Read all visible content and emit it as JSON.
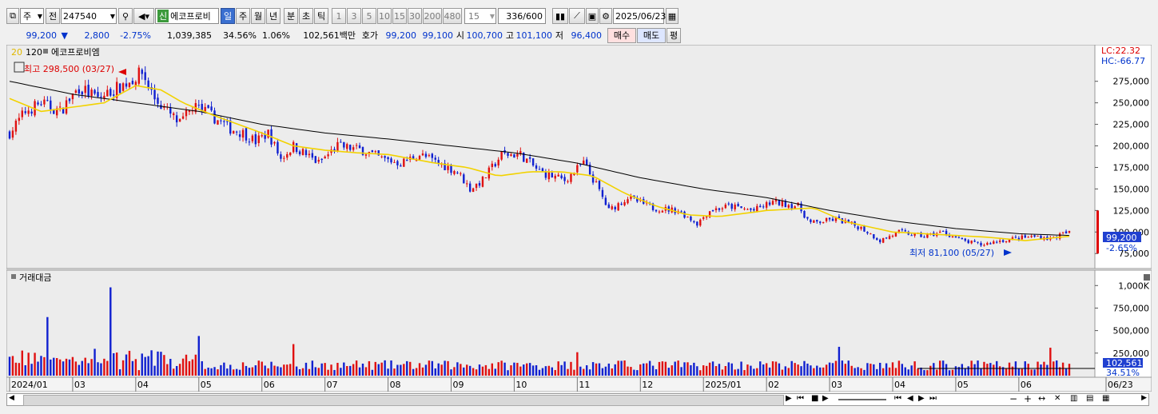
{
  "toolbar": {
    "period_select": "주",
    "prev_label": "전",
    "code": "247540",
    "name_badge": "신",
    "name": "에코프로비",
    "period_tabs": [
      "일",
      "주",
      "월",
      "년",
      "분",
      "초",
      "틱"
    ],
    "interval_buttons": [
      "1",
      "3",
      "5",
      "10",
      "15",
      "30",
      "200",
      "480"
    ],
    "interval_value": "15",
    "count_value": "336/600",
    "date_value": "2025/06/23"
  },
  "info": {
    "price": "99,200",
    "change": "2,800",
    "change_pct": "-2.75%",
    "volume": "1,039,385",
    "volume_ratio": "34.56%",
    "turnover_rate": "1.06%",
    "amount": "102,561백만",
    "ask_bid_label": "호가",
    "bid": "99,200",
    "ask": "99,100",
    "open_label": "시",
    "open": "100,700",
    "high_label": "고",
    "high": "101,100",
    "low_label": "저",
    "low": "96,400",
    "buy_label": "매수",
    "sell_label": "매도",
    "eval_label": "평"
  },
  "price_pane": {
    "legend_ma1": "20",
    "legend_ma2": "120",
    "legend_name": "에코프로비엠",
    "high_marker": "최고 298,500 (03/27)",
    "low_marker": "최저 81,100 (05/27)",
    "lc": "LC:22.32",
    "hc": "HC:-66.77",
    "current_price": "99,200",
    "current_pct": "-2.65%"
  },
  "volume_pane": {
    "title": "거래대금",
    "current": "102,561",
    "pct": "34.51%"
  },
  "colors": {
    "up": "#e01010",
    "down": "#1020d0",
    "ma20": "#f2d200",
    "ma120": "#000000"
  },
  "chart_data": {
    "type": "candlestick",
    "price_axis_ticks": [
      "275,000",
      "250,000",
      "225,000",
      "200,000",
      "175,000",
      "150,000",
      "125,000",
      "100,000",
      "75,000"
    ],
    "price_range": [
      65000,
      310000
    ],
    "volume_axis_ticks": [
      "1,000K",
      "750,000",
      "500,000",
      "250,000"
    ],
    "volume_range": [
      0,
      1100000
    ],
    "x_labels": [
      "2024/01",
      "03",
      "04",
      "05",
      "06",
      "07",
      "08",
      "09",
      "10",
      "11",
      "12",
      "2025/01",
      "02",
      "03",
      "04",
      "05",
      "06",
      "06/23"
    ],
    "x_label_index": [
      0,
      20,
      40,
      60,
      80,
      100,
      120,
      140,
      160,
      180,
      200,
      220,
      240,
      260,
      280,
      300,
      320,
      336
    ],
    "close_path": [
      [
        0,
        215000
      ],
      [
        5,
        240000
      ],
      [
        10,
        250000
      ],
      [
        16,
        240000
      ],
      [
        22,
        268000
      ],
      [
        28,
        255000
      ],
      [
        33,
        265000
      ],
      [
        38,
        275000
      ],
      [
        42,
        285000
      ],
      [
        44,
        270000
      ],
      [
        46,
        255000
      ],
      [
        50,
        240000
      ],
      [
        54,
        225000
      ],
      [
        58,
        245000
      ],
      [
        62,
        240000
      ],
      [
        66,
        230000
      ],
      [
        70,
        220000
      ],
      [
        74,
        215000
      ],
      [
        78,
        205000
      ],
      [
        82,
        215000
      ],
      [
        86,
        185000
      ],
      [
        90,
        200000
      ],
      [
        94,
        190000
      ],
      [
        98,
        180000
      ],
      [
        104,
        200000
      ],
      [
        112,
        195000
      ],
      [
        118,
        185000
      ],
      [
        124,
        180000
      ],
      [
        130,
        190000
      ],
      [
        136,
        180000
      ],
      [
        142,
        170000
      ],
      [
        146,
        150000
      ],
      [
        150,
        160000
      ],
      [
        156,
        190000
      ],
      [
        162,
        190000
      ],
      [
        168,
        170000
      ],
      [
        176,
        160000
      ],
      [
        182,
        180000
      ],
      [
        186,
        155000
      ],
      [
        190,
        125000
      ],
      [
        196,
        140000
      ],
      [
        204,
        128000
      ],
      [
        212,
        125000
      ],
      [
        218,
        110000
      ],
      [
        222,
        125000
      ],
      [
        228,
        130000
      ],
      [
        236,
        125000
      ],
      [
        242,
        135000
      ],
      [
        250,
        130000
      ],
      [
        254,
        110000
      ],
      [
        262,
        115000
      ],
      [
        270,
        105000
      ],
      [
        276,
        90000
      ],
      [
        282,
        100000
      ],
      [
        290,
        95000
      ],
      [
        296,
        100000
      ],
      [
        302,
        90000
      ],
      [
        308,
        85000
      ],
      [
        314,
        90000
      ],
      [
        320,
        93000
      ],
      [
        326,
        95000
      ],
      [
        330,
        92000
      ],
      [
        334,
        98000
      ],
      [
        336,
        99200
      ]
    ],
    "ma20_path": [
      [
        0,
        255000
      ],
      [
        10,
        240000
      ],
      [
        20,
        245000
      ],
      [
        30,
        250000
      ],
      [
        40,
        270000
      ],
      [
        48,
        265000
      ],
      [
        55,
        250000
      ],
      [
        65,
        235000
      ],
      [
        80,
        215000
      ],
      [
        90,
        200000
      ],
      [
        100,
        195000
      ],
      [
        110,
        192000
      ],
      [
        120,
        190000
      ],
      [
        135,
        180000
      ],
      [
        145,
        175000
      ],
      [
        155,
        165000
      ],
      [
        165,
        170000
      ],
      [
        175,
        170000
      ],
      [
        185,
        165000
      ],
      [
        195,
        145000
      ],
      [
        205,
        130000
      ],
      [
        215,
        120000
      ],
      [
        225,
        118000
      ],
      [
        240,
        125000
      ],
      [
        255,
        128000
      ],
      [
        265,
        112000
      ],
      [
        280,
        100000
      ],
      [
        295,
        97000
      ],
      [
        310,
        94000
      ],
      [
        322,
        90000
      ],
      [
        336,
        95000
      ]
    ],
    "ma120_path": [
      [
        0,
        275000
      ],
      [
        20,
        260000
      ],
      [
        40,
        250000
      ],
      [
        60,
        240000
      ],
      [
        80,
        225000
      ],
      [
        100,
        215000
      ],
      [
        120,
        208000
      ],
      [
        140,
        200000
      ],
      [
        160,
        192000
      ],
      [
        180,
        180000
      ],
      [
        200,
        163000
      ],
      [
        220,
        150000
      ],
      [
        240,
        140000
      ],
      [
        260,
        125000
      ],
      [
        280,
        113000
      ],
      [
        300,
        104000
      ],
      [
        320,
        98000
      ],
      [
        336,
        96000
      ]
    ],
    "volume_spikes": [
      [
        12,
        650000
      ],
      [
        32,
        980000
      ],
      [
        60,
        440000
      ],
      [
        90,
        350000
      ],
      [
        180,
        260000
      ],
      [
        263,
        320000
      ],
      [
        330,
        310000
      ]
    ]
  }
}
